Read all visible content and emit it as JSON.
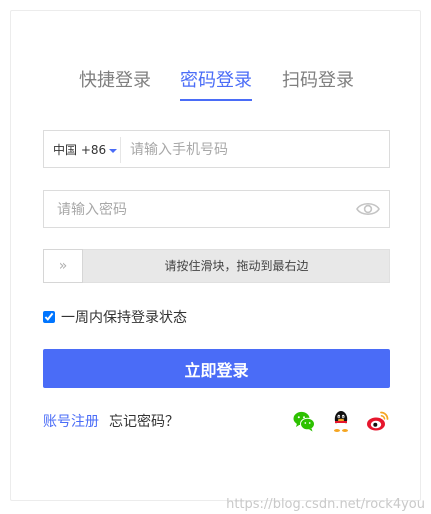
{
  "tabs": [
    {
      "label": "快捷登录",
      "active": false
    },
    {
      "label": "密码登录",
      "active": true
    },
    {
      "label": "扫码登录",
      "active": false
    }
  ],
  "phone": {
    "country": "中国 +86",
    "placeholder": "请输入手机号码",
    "value": ""
  },
  "password": {
    "placeholder": "请输入密码",
    "value": "",
    "toggle_icon": "eye-icon"
  },
  "slider": {
    "handle_glyph": "»",
    "text": "请按住滑块，拖动到最右边",
    "progress": 0
  },
  "remember": {
    "label": "一周内保持登录状态",
    "checked": true
  },
  "login_button": "立即登录",
  "links": {
    "register": "账号注册",
    "forgot": "忘记密码？"
  },
  "social": [
    {
      "name": "wechat-icon",
      "color": "#2dc100"
    },
    {
      "name": "qq-icon",
      "color": "#000000"
    },
    {
      "name": "weibo-icon",
      "color": "#e6162d"
    }
  ],
  "watermark": "https://blog.csdn.net/rock4you",
  "colors": {
    "accent": "#4a6cf7",
    "muted_text": "#7f7f7f",
    "border": "#dcdcdc"
  }
}
